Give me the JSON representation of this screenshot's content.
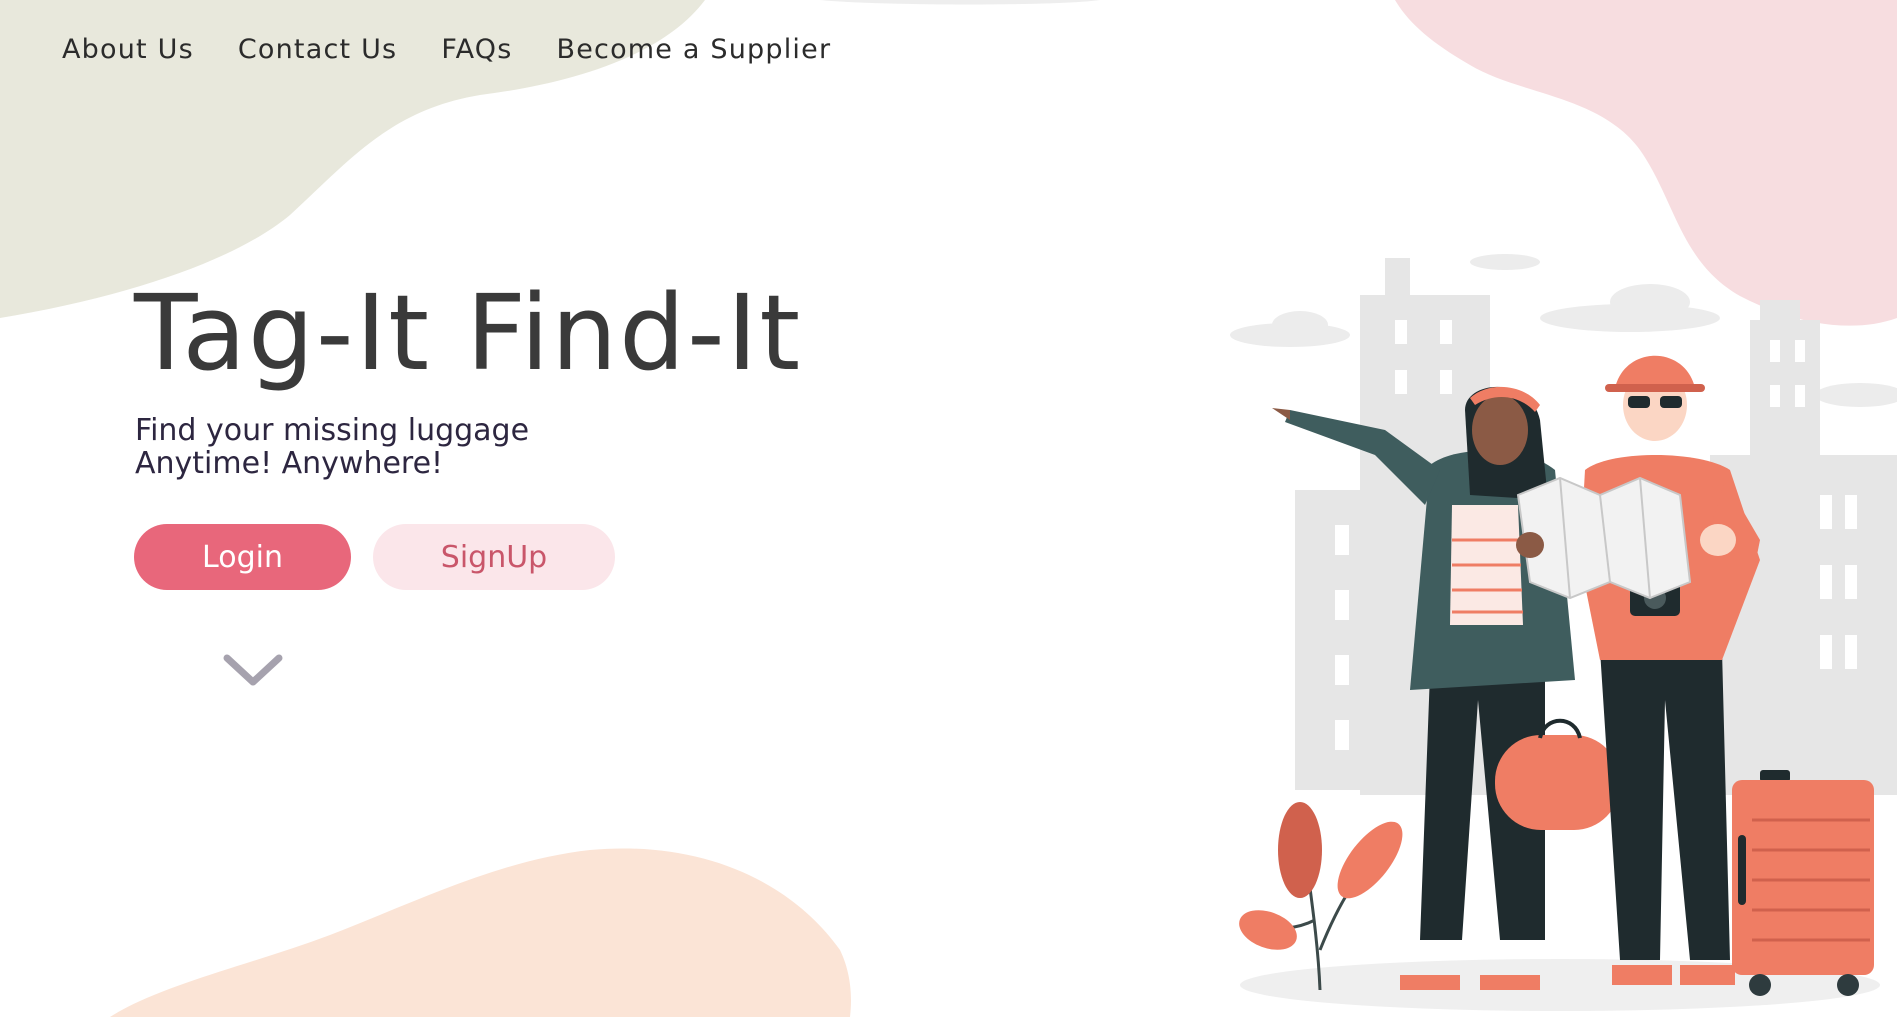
{
  "nav": {
    "items": [
      "About Us",
      "Contact Us",
      "FAQs",
      "Become a Supplier"
    ]
  },
  "hero": {
    "title": "Tag-It Find-It",
    "tagline_line1": "Find your missing luggage",
    "tagline_line2": "Anytime! Anywhere!"
  },
  "buttons": {
    "login": "Login",
    "signup": "SignUp"
  },
  "icons": {
    "scroll": "chevron-down-icon"
  },
  "colors": {
    "primary": "#e8677b",
    "primary_light": "#fbe6ea",
    "blob_green": "#e8e8dc",
    "blob_pink": "#f7dde0",
    "blob_peach": "#fbe4d6",
    "title_text": "#3a3a3a"
  }
}
